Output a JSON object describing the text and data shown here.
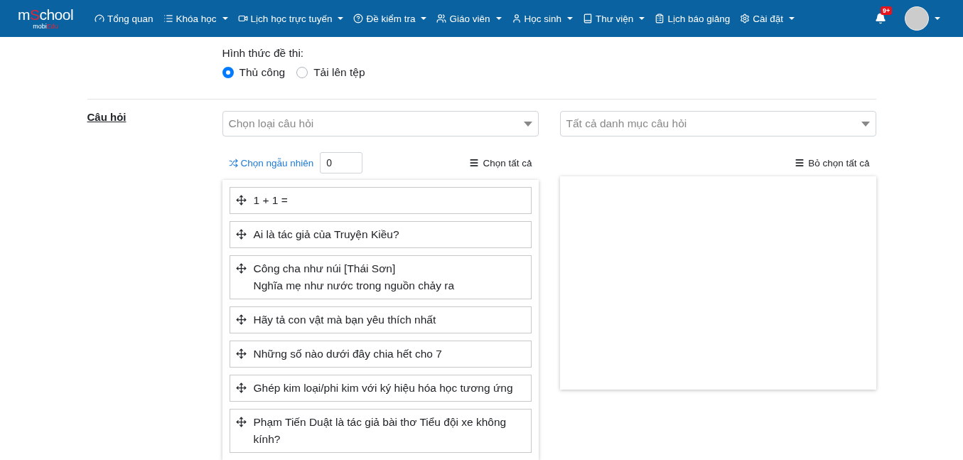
{
  "logo": {
    "main_prefix": "m",
    "main_accent": "S",
    "main_rest": "chool",
    "sub_prefix": "mobi",
    "sub_accent": "Edu"
  },
  "nav": [
    {
      "label": "Tổng quan",
      "dropdown": false
    },
    {
      "label": "Khóa học",
      "dropdown": true
    },
    {
      "label": "Lịch học trực tuyến",
      "dropdown": true
    },
    {
      "label": "Đề kiểm tra",
      "dropdown": true
    },
    {
      "label": "Giáo viên",
      "dropdown": true
    },
    {
      "label": "Học sinh",
      "dropdown": true
    },
    {
      "label": "Thư viện",
      "dropdown": true
    },
    {
      "label": "Lịch báo giảng",
      "dropdown": false
    },
    {
      "label": "Cài đặt",
      "dropdown": true
    }
  ],
  "notifications": {
    "badge": "9+"
  },
  "exam_form": {
    "label": "Hình thức đề thi:",
    "options": [
      {
        "label": "Thủ công",
        "selected": true
      },
      {
        "label": "Tải lên tệp",
        "selected": false
      }
    ]
  },
  "questions": {
    "label": "Câu hỏi",
    "type_select": {
      "placeholder": "Chọn loại câu hỏi"
    },
    "category_select": {
      "placeholder": "Tất cả danh mục câu hỏi"
    },
    "random_link": "Chọn ngẫu nhiên",
    "random_count": "0",
    "select_all": "Chọn tất cả",
    "deselect_all": "Bỏ chọn tất cả",
    "items": [
      {
        "lines": [
          "1 + 1 ="
        ]
      },
      {
        "lines": [
          "Ai là tác giả của Truyện Kiều?"
        ]
      },
      {
        "lines": [
          "Công cha như núi [Thái Sơn]",
          "Nghĩa mẹ như nước trong nguồn chảy ra"
        ]
      },
      {
        "lines": [
          "Hãy tả con vật mà bạn yêu thích nhất"
        ]
      },
      {
        "lines": [
          "Những số nào dưới đây chia hết cho 7"
        ]
      },
      {
        "lines": [
          "Ghép kim loại/phi kim với ký hiệu hóa học tương ứng"
        ]
      },
      {
        "lines": [
          "Phạm Tiến Duật là tác giả bài thơ Tiểu đội xe không kính?"
        ]
      }
    ]
  }
}
